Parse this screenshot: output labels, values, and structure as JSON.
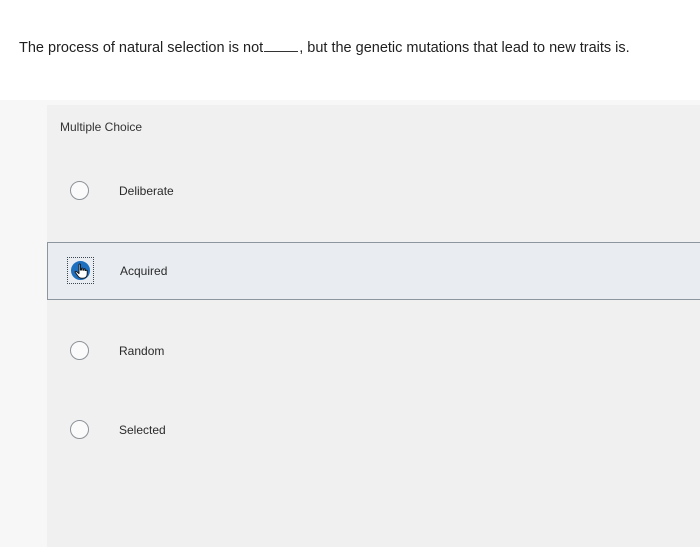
{
  "question": {
    "text_before": "The process of natural selection is not",
    "text_after": ", but the genetic mutations that lead to new traits is."
  },
  "quiz": {
    "type_label": "Multiple Choice",
    "options": [
      {
        "label": "Deliberate",
        "selected": false
      },
      {
        "label": "Acquired",
        "selected": true
      },
      {
        "label": "Random",
        "selected": false
      },
      {
        "label": "Selected",
        "selected": false
      }
    ]
  },
  "colors": {
    "selected_radio": "#1f6fbf",
    "selected_row_bg": "#e9edf1"
  }
}
